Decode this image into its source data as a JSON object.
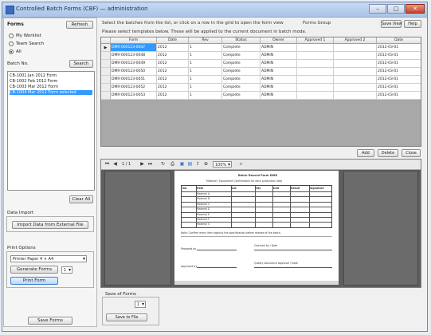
{
  "window": {
    "title": "Controlled Batch Forms (CBF) — administration",
    "min_label": "–",
    "max_label": "□",
    "close_label": "✕"
  },
  "left": {
    "header": "Forms",
    "header_button": "Refresh",
    "radios": [
      {
        "label": "My Worklist",
        "checked": false
      },
      {
        "label": "Team Search",
        "checked": false
      },
      {
        "label": "All",
        "checked": true
      }
    ],
    "list_label": "Batch No.",
    "list_button": "Search",
    "list_items": [
      {
        "text": "CB-1001  Jan 2012  Form",
        "selected": false
      },
      {
        "text": "CB-1002  Feb 2012  Form",
        "selected": false
      },
      {
        "text": "CB-1003  Mar 2012  Form",
        "selected": false
      },
      {
        "text": "CB-1004  Mar 2012  Form selected",
        "selected": true
      }
    ],
    "clear_button": "Clear All",
    "stage_label": "Data Import",
    "load_button": "Import Data from External File",
    "print_label": "Print Options",
    "print_combo": "Printer  Paper 4 × A4",
    "generate_button": "Generate Forms",
    "generate_count": "1",
    "print_button": "Print Form",
    "bottom_button": "Save Forms"
  },
  "top": {
    "line1": "Select the batches from the list, or click on a row in the grid to open the form view",
    "line1_right": "Forms Group",
    "line2": "Please select templates below. These will be applied to the current document in batch mode.",
    "btn1": "Save View",
    "btn2": "Help"
  },
  "grid": {
    "columns": [
      "",
      "Form",
      "Date",
      "Rev",
      "Status",
      "Owner",
      "Approved 1",
      "Approved 2",
      "Date"
    ],
    "rows": [
      [
        "▶",
        "DMR-000123-0047",
        "2012",
        "1",
        "Complete",
        "ADMIN",
        "",
        "",
        "2012-03-01"
      ],
      [
        "",
        "DMR-000123-0048",
        "2012",
        "1",
        "Complete",
        "ADMIN",
        "",
        "",
        "2012-03-01"
      ],
      [
        "",
        "DMR-000123-0049",
        "2012",
        "1",
        "Complete",
        "ADMIN",
        "",
        "",
        "2012-03-01"
      ],
      [
        "",
        "DMR-000123-0050",
        "2012",
        "1",
        "Complete",
        "ADMIN",
        "",
        "",
        "2012-03-01"
      ],
      [
        "",
        "DMR-000123-0051",
        "2012",
        "1",
        "Complete",
        "ADMIN",
        "",
        "",
        "2012-03-01"
      ],
      [
        "",
        "DMR-000123-0052",
        "2012",
        "1",
        "Complete",
        "ADMIN",
        "",
        "",
        "2012-03-01"
      ],
      [
        "",
        "DMR-000123-0053",
        "2012",
        "1",
        "Complete",
        "ADMIN",
        "",
        "",
        "2012-03-01"
      ]
    ]
  },
  "grid_buttons": [
    "Add",
    "Delete",
    "Close"
  ],
  "viewer": {
    "page_indicator": "1 / 1",
    "zoom": "100%",
    "doc_title": "Batch Record Form  DMR",
    "doc_subtitle": "Material / Equipment Confirmation for each production step",
    "doc_header_cols": [
      "No.",
      "Item",
      "Lot",
      "Qty",
      "Unit",
      "Result",
      "Signature"
    ],
    "doc_rows": [
      "Material A",
      "Material B",
      "Material C",
      "Material D",
      "Material E",
      "Material F",
      "Material G"
    ],
    "doc_note": "Note: Confirm every item against the specification before release of the batch.",
    "sign1": "Prepared by",
    "sign2": "Checked by / Date",
    "sign3": "Approved by",
    "sign4": "Quality Assurance Approval / Date"
  },
  "bottom": {
    "label": "Save of Forms",
    "combo": "1",
    "button": "Save to File"
  }
}
